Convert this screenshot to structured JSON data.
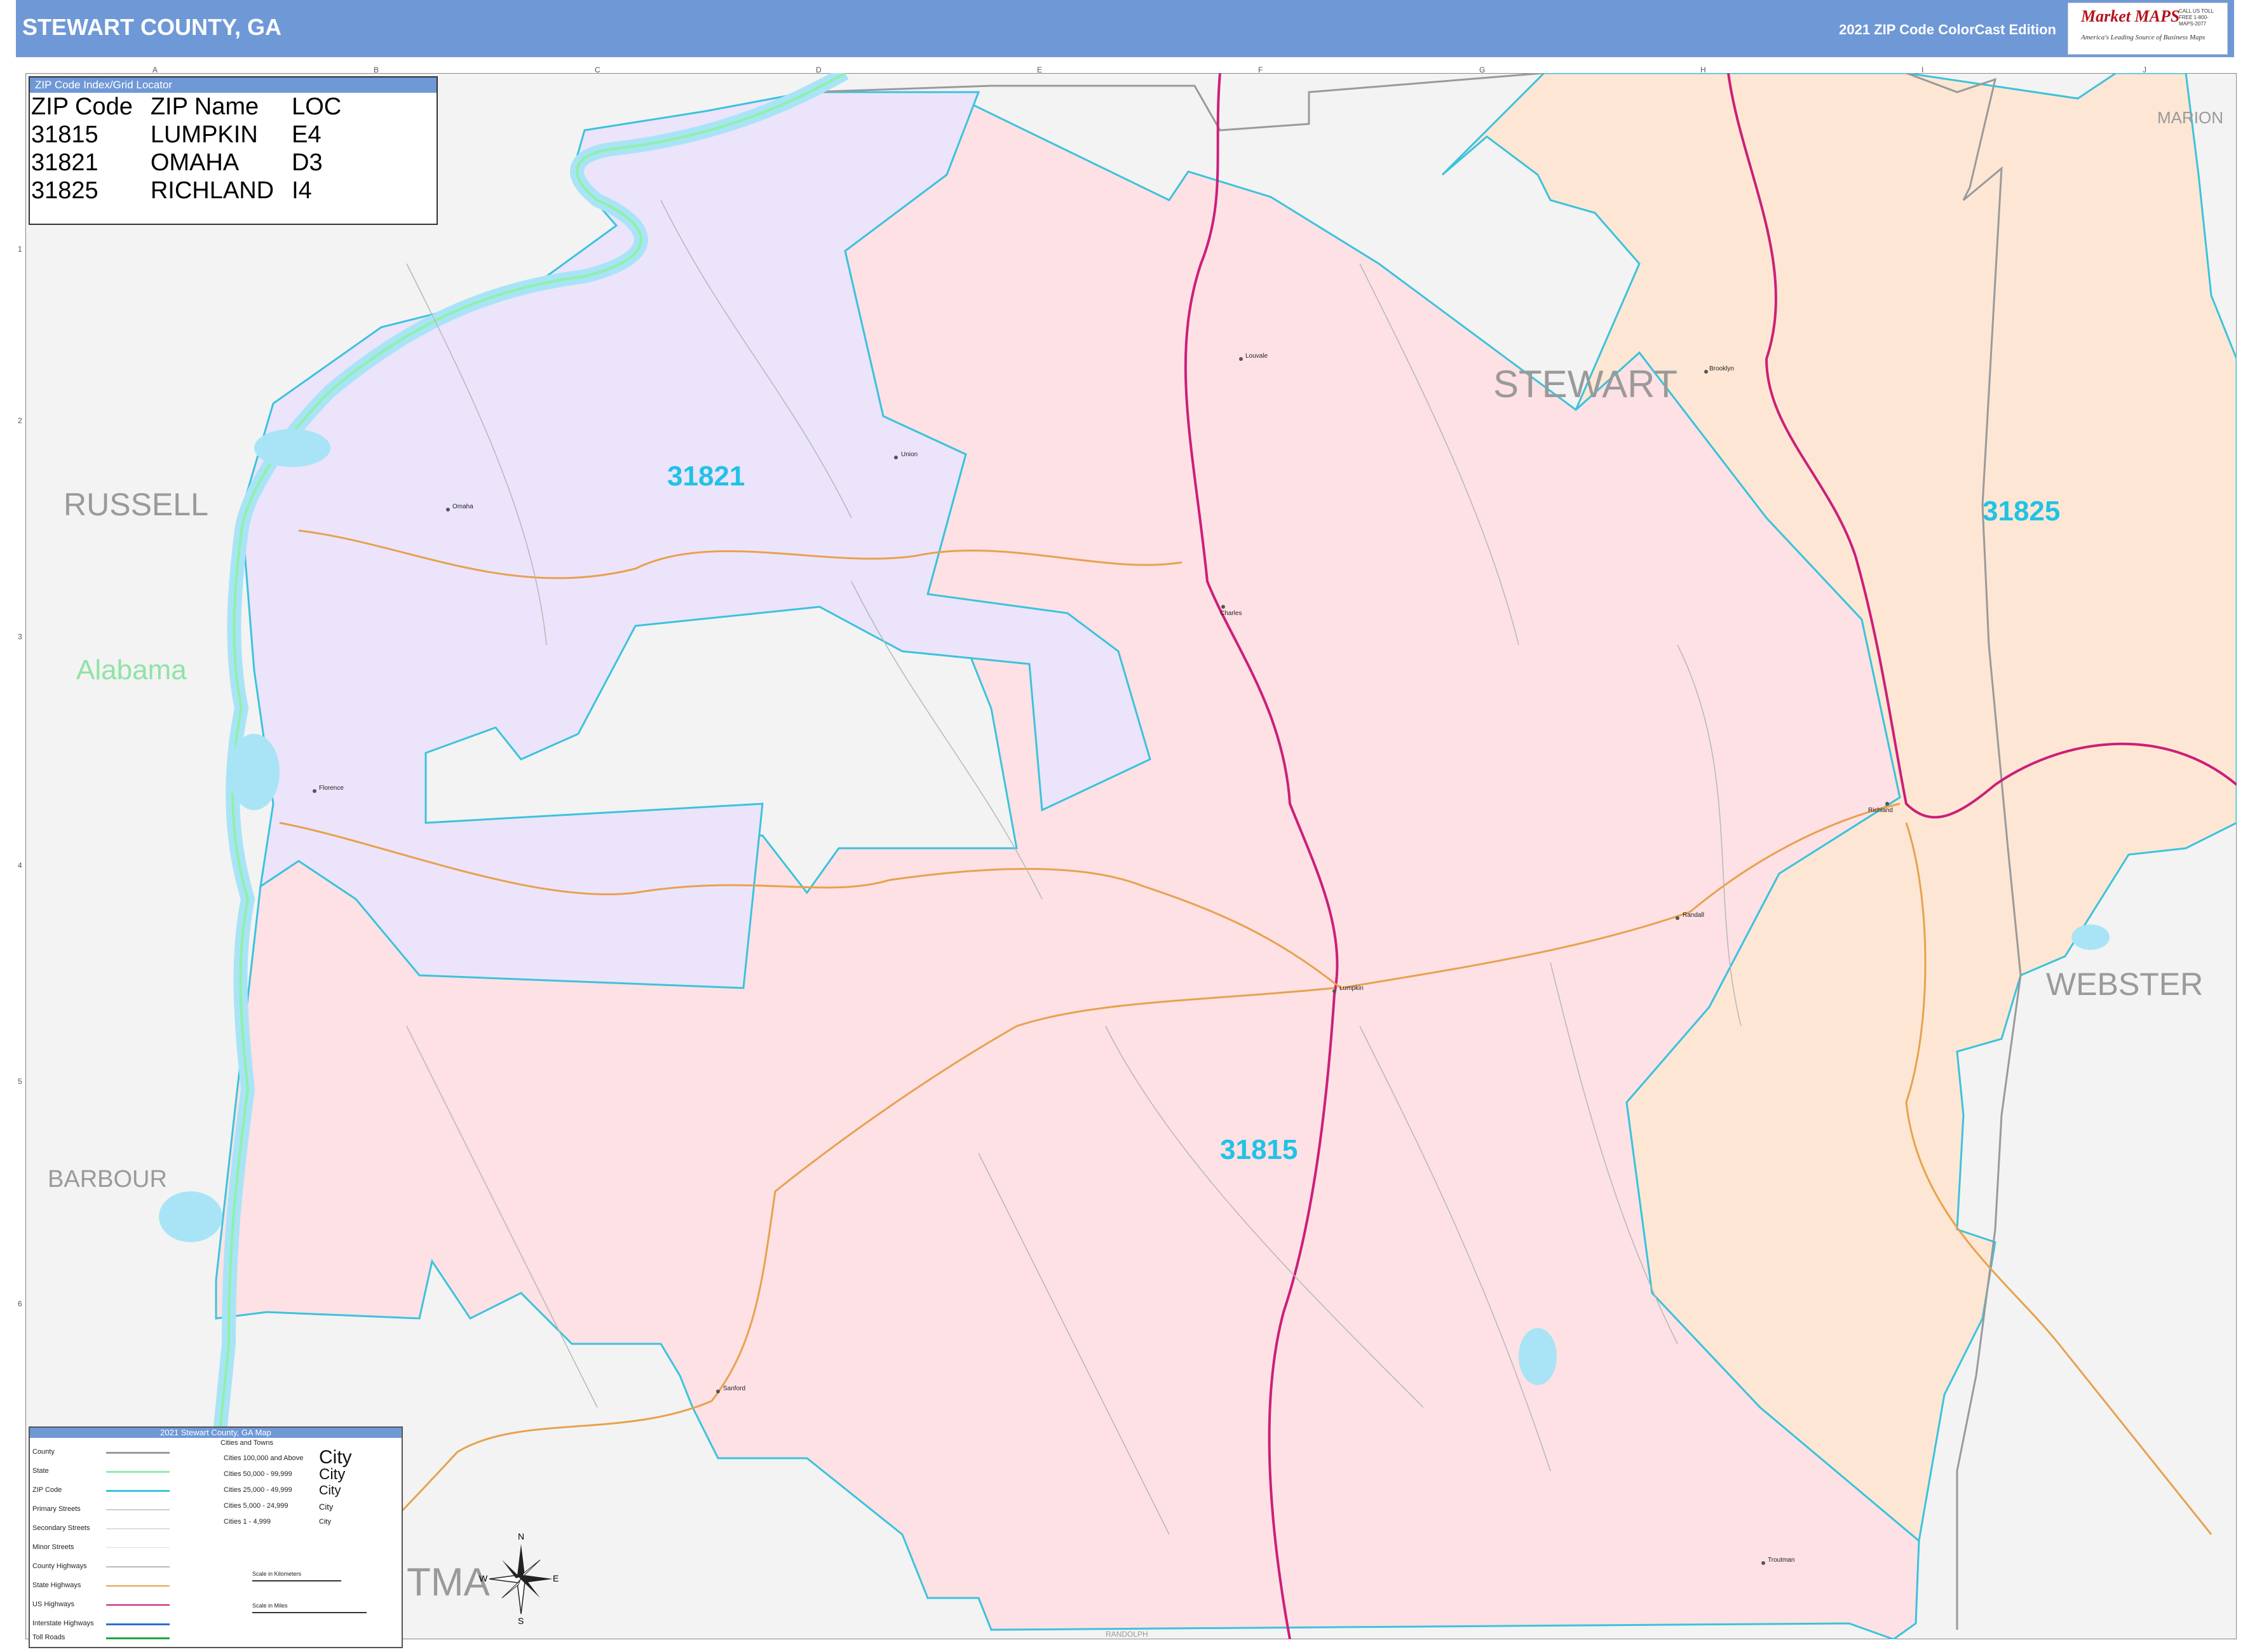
{
  "header": {
    "title": "STEWART COUNTY, GA",
    "edition": "2021 ZIP Code ColorCast Edition",
    "logo": {
      "brand_top": "Market",
      "brand_bottom": "MAPS",
      "tagline": "America's Leading Source of Business Maps",
      "contact": "CALL US TOLL FREE 1-800-MAPS-2077"
    }
  },
  "grid": {
    "columns": [
      "A",
      "B",
      "C",
      "D",
      "E",
      "F",
      "G",
      "H",
      "I",
      "J"
    ],
    "rows": [
      "1",
      "2",
      "3",
      "4",
      "5",
      "6"
    ]
  },
  "index": {
    "title": "ZIP Code Index/Grid Locator",
    "headers": [
      "ZIP Code",
      "ZIP Name",
      "LOC"
    ],
    "rows": [
      [
        "31815",
        "LUMPKIN",
        "E4"
      ],
      [
        "31821",
        "OMAHA",
        "D3"
      ],
      [
        "31825",
        "RICHLAND",
        "I4"
      ]
    ]
  },
  "counties": {
    "stewart": "STEWART",
    "russell": "RUSSELL",
    "barbour": "BARBOUR",
    "marion": "MARION",
    "webster": "WEBSTER",
    "quitman": "TMA",
    "randolph": "RANDOLPH"
  },
  "state_label": "Alabama",
  "zips": {
    "z31821": "31821",
    "z31825": "31825",
    "z31815": "31815"
  },
  "towns": {
    "omaha": "Omaha",
    "union": "Union",
    "louvale": "Louvale",
    "brooklyn": "Brooklyn",
    "richland": "Richland",
    "florence": "Florence",
    "randall": "Randall",
    "lumpkin": "Lumpkin",
    "sanford": "Sanford",
    "troutman": "Troutman",
    "charles": "Charles"
  },
  "legend": {
    "title": "2021 Stewart County, GA Map",
    "rows": [
      "County",
      "State",
      "ZIP Code",
      "Primary Streets",
      "Secondary Streets",
      "Minor Streets",
      "County Highways",
      "State Highways",
      "US Highways",
      "Interstate Highways",
      "Toll Roads"
    ],
    "cities_title": "Cities and Towns",
    "cities": [
      "Cities 100,000 and Above",
      "Cities 50,000 - 99,999",
      "Cities 25,000 - 49,999",
      "Cities 5,000 - 24,999",
      "Cities 1 - 4,999"
    ],
    "city_word": "City",
    "scale_km": "Scale in Kilometers",
    "scale_mi": "Scale in Miles"
  },
  "compass": {
    "n": "N",
    "s": "S",
    "e": "E",
    "w": "W"
  },
  "colors": {
    "header": "#6f98d6",
    "zip_31821": "#ece4fb",
    "zip_31815": "#fde1e4",
    "zip_31825": "#fde7d4",
    "outside": "#f3f3f3",
    "water": "#a8e4f6",
    "zip_border": "#3bc3dd",
    "state_border": "#8ff0a8",
    "us_highway": "#cc1f7a",
    "state_highway": "#e8a14e"
  }
}
